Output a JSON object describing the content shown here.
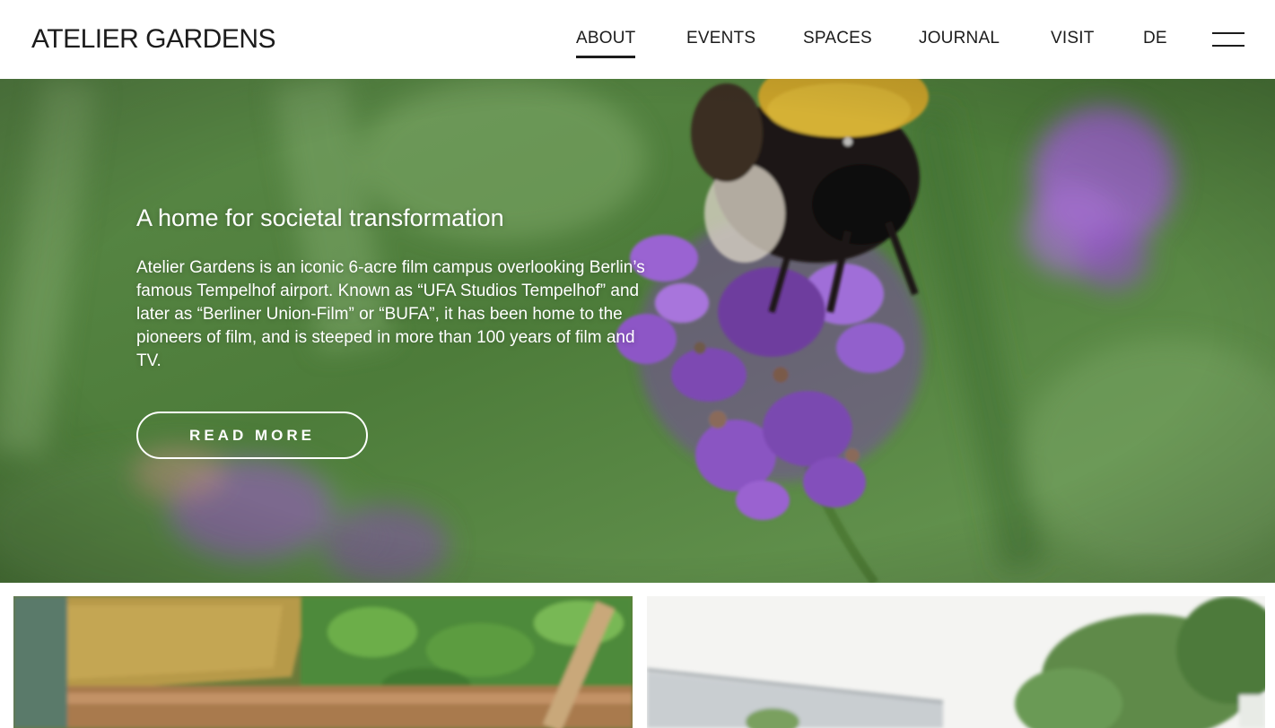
{
  "header": {
    "logo": "ATELIER GARDENS",
    "nav": [
      {
        "label": "ABOUT",
        "active": true
      },
      {
        "label": "EVENTS",
        "active": false
      },
      {
        "label": "SPACES",
        "active": false
      },
      {
        "label": "JOURNAL",
        "active": false
      },
      {
        "label": "VISIT",
        "active": false
      },
      {
        "label": "DE",
        "active": false
      }
    ],
    "menu_icon": "hamburger-menu-icon"
  },
  "hero": {
    "title": "A home for societal transformation",
    "text": "Atelier Gardens is an iconic 6-acre film campus overlooking Berlin’s famous Tempelhof airport. Known as “UFA Studios Tempelhof” and later as “Berliner Union-Film” or “BUFA”, it has been home to the pioneers of film, and is steeped in more than 100 years of film and TV.",
    "button_label": "READ MORE",
    "image": "bumblebee-on-lavender-photo"
  },
  "cards": [
    {
      "image": "wooden-planter-straw-photo"
    },
    {
      "image": "garden-building-trees-photo"
    }
  ],
  "colors": {
    "text": "#1c1c1c",
    "background": "#ffffff",
    "hero_text": "#ffffff"
  }
}
